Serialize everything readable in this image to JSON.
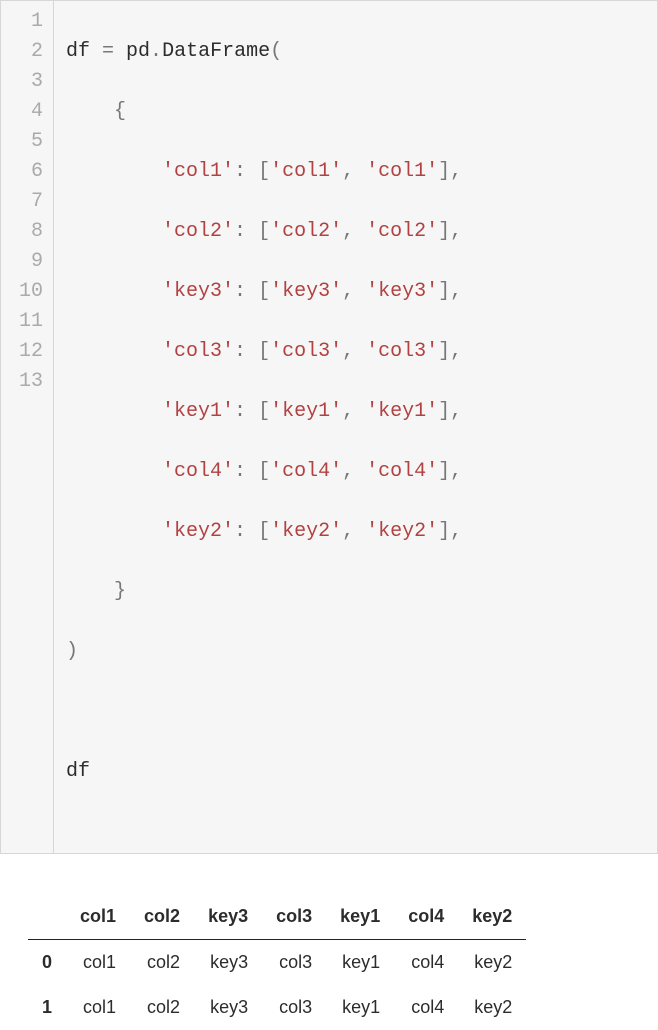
{
  "code": {
    "line_numbers": [
      "1",
      "2",
      "3",
      "4",
      "5",
      "6",
      "7",
      "8",
      "9",
      "10",
      "11",
      "12",
      "13"
    ],
    "tokens": {
      "l1_a": "df ",
      "l1_eq": "=",
      "l1_b": " pd",
      "l1_dot": ".",
      "l1_c": "DataFrame",
      "l1_paren": "(",
      "l2_brace": "{",
      "key_col1": "'col1'",
      "key_col2": "'col2'",
      "key_key3": "'key3'",
      "key_col3": "'col3'",
      "key_key1": "'key1'",
      "key_col4": "'col4'",
      "key_key2": "'key2'",
      "v_col1a": "'col1'",
      "v_col1b": "'col1'",
      "v_col2a": "'col2'",
      "v_col2b": "'col2'",
      "v_key3a": "'key3'",
      "v_key3b": "'key3'",
      "v_col3a": "'col3'",
      "v_col3b": "'col3'",
      "v_key1a": "'key1'",
      "v_key1b": "'key1'",
      "v_col4a": "'col4'",
      "v_col4b": "'col4'",
      "v_key2a": "'key2'",
      "v_key2b": "'key2'",
      "colon": ":",
      "lbrack": "[",
      "rbrack": "]",
      "comma": ",",
      "l10_brace": "}",
      "l11_paren": ")",
      "l13": "df"
    }
  },
  "dataframe": {
    "columns": [
      "col1",
      "col2",
      "key3",
      "col3",
      "key1",
      "col4",
      "key2"
    ],
    "index": [
      "0",
      "1"
    ],
    "rows": [
      [
        "col1",
        "col2",
        "key3",
        "col3",
        "key1",
        "col4",
        "key2"
      ],
      [
        "col1",
        "col2",
        "key3",
        "col3",
        "key1",
        "col4",
        "key2"
      ]
    ]
  }
}
